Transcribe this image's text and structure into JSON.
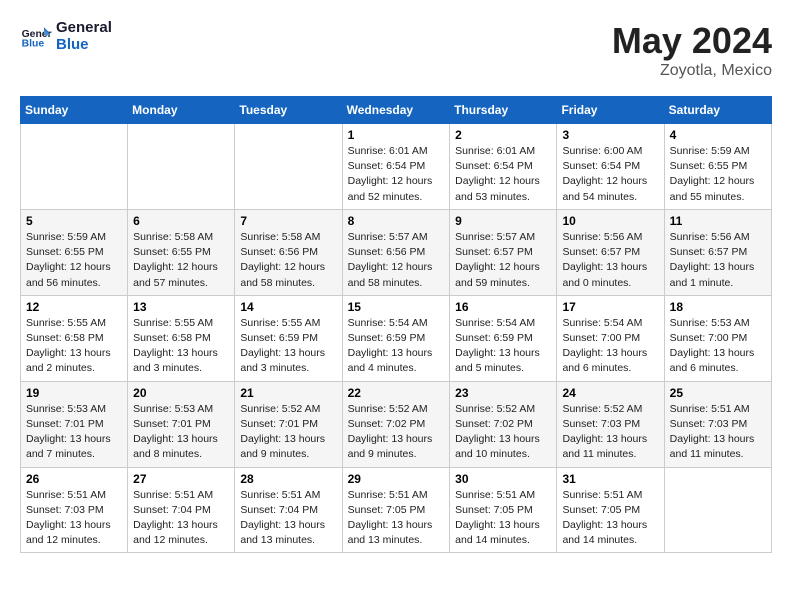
{
  "header": {
    "logo_general": "General",
    "logo_blue": "Blue",
    "month_title": "May 2024",
    "location": "Zoyotla, Mexico"
  },
  "weekdays": [
    "Sunday",
    "Monday",
    "Tuesday",
    "Wednesday",
    "Thursday",
    "Friday",
    "Saturday"
  ],
  "weeks": [
    [
      {
        "day": "",
        "info": ""
      },
      {
        "day": "",
        "info": ""
      },
      {
        "day": "",
        "info": ""
      },
      {
        "day": "1",
        "info": "Sunrise: 6:01 AM\nSunset: 6:54 PM\nDaylight: 12 hours\nand 52 minutes."
      },
      {
        "day": "2",
        "info": "Sunrise: 6:01 AM\nSunset: 6:54 PM\nDaylight: 12 hours\nand 53 minutes."
      },
      {
        "day": "3",
        "info": "Sunrise: 6:00 AM\nSunset: 6:54 PM\nDaylight: 12 hours\nand 54 minutes."
      },
      {
        "day": "4",
        "info": "Sunrise: 5:59 AM\nSunset: 6:55 PM\nDaylight: 12 hours\nand 55 minutes."
      }
    ],
    [
      {
        "day": "5",
        "info": "Sunrise: 5:59 AM\nSunset: 6:55 PM\nDaylight: 12 hours\nand 56 minutes."
      },
      {
        "day": "6",
        "info": "Sunrise: 5:58 AM\nSunset: 6:55 PM\nDaylight: 12 hours\nand 57 minutes."
      },
      {
        "day": "7",
        "info": "Sunrise: 5:58 AM\nSunset: 6:56 PM\nDaylight: 12 hours\nand 58 minutes."
      },
      {
        "day": "8",
        "info": "Sunrise: 5:57 AM\nSunset: 6:56 PM\nDaylight: 12 hours\nand 58 minutes."
      },
      {
        "day": "9",
        "info": "Sunrise: 5:57 AM\nSunset: 6:57 PM\nDaylight: 12 hours\nand 59 minutes."
      },
      {
        "day": "10",
        "info": "Sunrise: 5:56 AM\nSunset: 6:57 PM\nDaylight: 13 hours\nand 0 minutes."
      },
      {
        "day": "11",
        "info": "Sunrise: 5:56 AM\nSunset: 6:57 PM\nDaylight: 13 hours\nand 1 minute."
      }
    ],
    [
      {
        "day": "12",
        "info": "Sunrise: 5:55 AM\nSunset: 6:58 PM\nDaylight: 13 hours\nand 2 minutes."
      },
      {
        "day": "13",
        "info": "Sunrise: 5:55 AM\nSunset: 6:58 PM\nDaylight: 13 hours\nand 3 minutes."
      },
      {
        "day": "14",
        "info": "Sunrise: 5:55 AM\nSunset: 6:59 PM\nDaylight: 13 hours\nand 3 minutes."
      },
      {
        "day": "15",
        "info": "Sunrise: 5:54 AM\nSunset: 6:59 PM\nDaylight: 13 hours\nand 4 minutes."
      },
      {
        "day": "16",
        "info": "Sunrise: 5:54 AM\nSunset: 6:59 PM\nDaylight: 13 hours\nand 5 minutes."
      },
      {
        "day": "17",
        "info": "Sunrise: 5:54 AM\nSunset: 7:00 PM\nDaylight: 13 hours\nand 6 minutes."
      },
      {
        "day": "18",
        "info": "Sunrise: 5:53 AM\nSunset: 7:00 PM\nDaylight: 13 hours\nand 6 minutes."
      }
    ],
    [
      {
        "day": "19",
        "info": "Sunrise: 5:53 AM\nSunset: 7:01 PM\nDaylight: 13 hours\nand 7 minutes."
      },
      {
        "day": "20",
        "info": "Sunrise: 5:53 AM\nSunset: 7:01 PM\nDaylight: 13 hours\nand 8 minutes."
      },
      {
        "day": "21",
        "info": "Sunrise: 5:52 AM\nSunset: 7:01 PM\nDaylight: 13 hours\nand 9 minutes."
      },
      {
        "day": "22",
        "info": "Sunrise: 5:52 AM\nSunset: 7:02 PM\nDaylight: 13 hours\nand 9 minutes."
      },
      {
        "day": "23",
        "info": "Sunrise: 5:52 AM\nSunset: 7:02 PM\nDaylight: 13 hours\nand 10 minutes."
      },
      {
        "day": "24",
        "info": "Sunrise: 5:52 AM\nSunset: 7:03 PM\nDaylight: 13 hours\nand 11 minutes."
      },
      {
        "day": "25",
        "info": "Sunrise: 5:51 AM\nSunset: 7:03 PM\nDaylight: 13 hours\nand 11 minutes."
      }
    ],
    [
      {
        "day": "26",
        "info": "Sunrise: 5:51 AM\nSunset: 7:03 PM\nDaylight: 13 hours\nand 12 minutes."
      },
      {
        "day": "27",
        "info": "Sunrise: 5:51 AM\nSunset: 7:04 PM\nDaylight: 13 hours\nand 12 minutes."
      },
      {
        "day": "28",
        "info": "Sunrise: 5:51 AM\nSunset: 7:04 PM\nDaylight: 13 hours\nand 13 minutes."
      },
      {
        "day": "29",
        "info": "Sunrise: 5:51 AM\nSunset: 7:05 PM\nDaylight: 13 hours\nand 13 minutes."
      },
      {
        "day": "30",
        "info": "Sunrise: 5:51 AM\nSunset: 7:05 PM\nDaylight: 13 hours\nand 14 minutes."
      },
      {
        "day": "31",
        "info": "Sunrise: 5:51 AM\nSunset: 7:05 PM\nDaylight: 13 hours\nand 14 minutes."
      },
      {
        "day": "",
        "info": ""
      }
    ]
  ]
}
